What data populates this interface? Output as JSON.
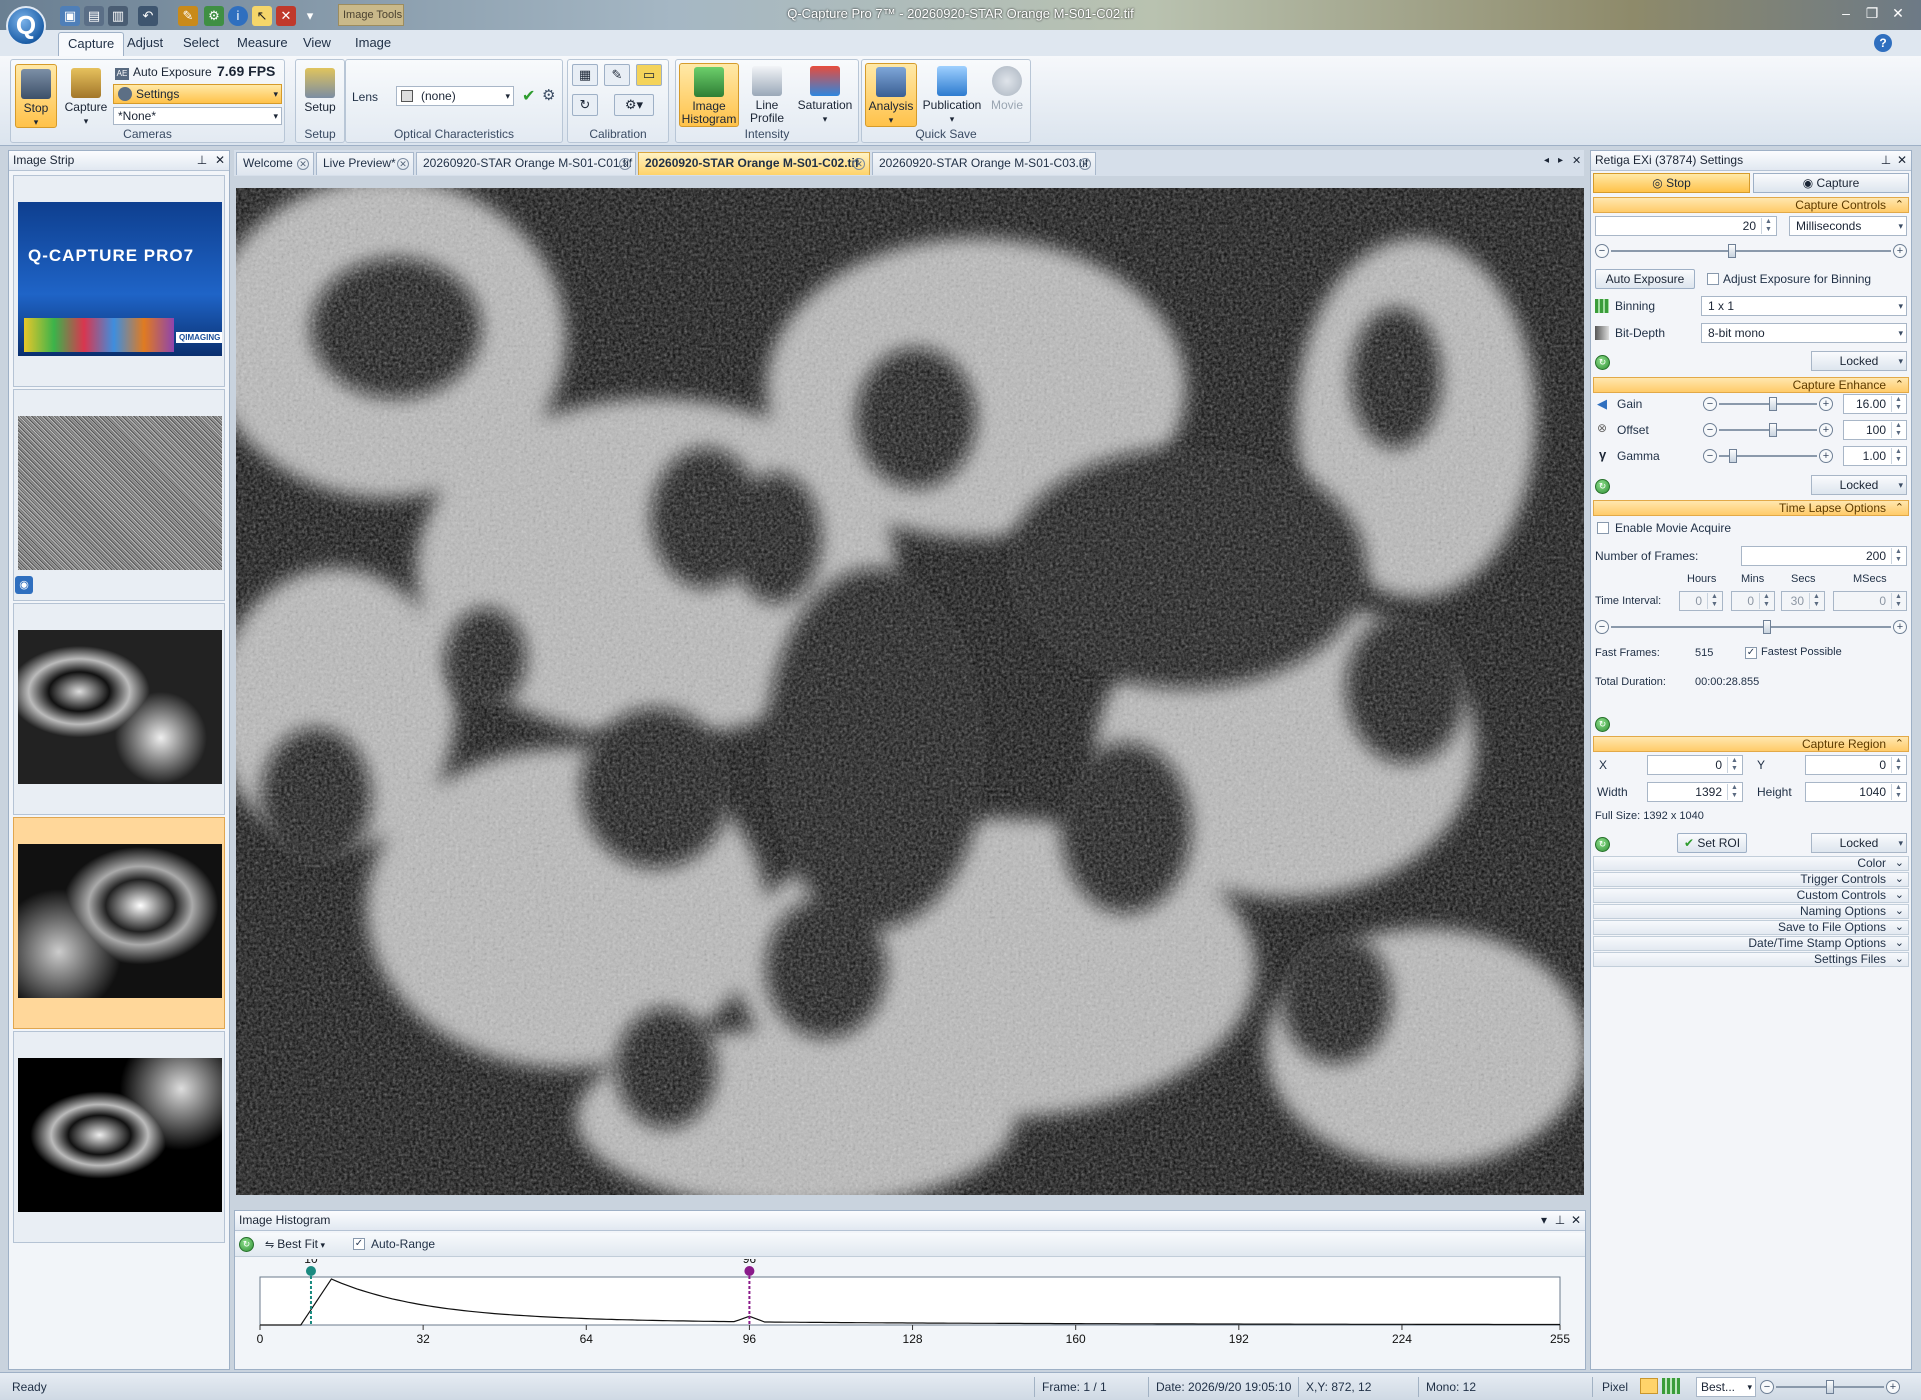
{
  "window": {
    "title": "Q-Capture Pro 7™ - 20260920-STAR Orange M-S01-C02.tif",
    "context_tab": "Image Tools",
    "logo_letter": "Q"
  },
  "ribbon": {
    "tabs": [
      "Capture",
      "Adjust",
      "Select",
      "Measure",
      "View",
      "Image"
    ],
    "active_tab": "Capture",
    "cameras": {
      "group_label": "Cameras",
      "stop": "Stop",
      "capture": "Capture",
      "auto_exposure": "Auto Exposure",
      "fps": "7.69 FPS",
      "settings": "Settings",
      "preset": "*None*"
    },
    "setup": {
      "group_label": "Setup",
      "button": "Setup"
    },
    "optical": {
      "group_label": "Optical Characteristics",
      "lens_label": "Lens",
      "lens_value": "(none)"
    },
    "calibration": {
      "group_label": "Calibration"
    },
    "intensity": {
      "group_label": "Intensity",
      "histogram": "Image Histogram",
      "line_profile": "Line Profile",
      "saturation": "Saturation"
    },
    "quick_save": {
      "group_label": "Quick Save",
      "analysis": "Analysis",
      "publication": "Publication",
      "movie": "Movie"
    }
  },
  "image_strip": {
    "title": "Image Strip",
    "splash_title": "Q-CAPTURE PRO7",
    "splash_brand": "QIMAGING"
  },
  "doc_tabs": [
    {
      "label": "Welcome"
    },
    {
      "label": "Live Preview*"
    },
    {
      "label": "20260920-STAR Orange M-S01-C01.tif"
    },
    {
      "label": "20260920-STAR Orange M-S01-C02.tif"
    },
    {
      "label": "20260920-STAR Orange M-S01-C03.tif"
    }
  ],
  "histogram": {
    "title": "Image Histogram",
    "fit": "Best Fit",
    "auto_range": "Auto-Range",
    "auto_range_checked": true,
    "low_marker": 10,
    "high_marker": 96,
    "ticks": [
      0,
      32,
      64,
      96,
      128,
      160,
      192,
      224,
      255
    ],
    "low_marker_color": "#1a8a80",
    "high_marker_color": "#8a1a8a"
  },
  "settings": {
    "title": "Retiga EXi (37874) Settings",
    "stop_tab": "Stop",
    "capture_tab": "Capture",
    "capture_controls": {
      "title": "Capture Controls",
      "exposure": "20",
      "unit": "Milliseconds",
      "auto_exposure_button": "Auto Exposure",
      "adjust_binning_label": "Adjust Exposure for Binning",
      "binning_label": "Binning",
      "binning_value": "1 x 1",
      "bitdepth_label": "Bit-Depth",
      "bitdepth_value": "8-bit mono",
      "locked": "Locked"
    },
    "capture_enhance": {
      "title": "Capture Enhance",
      "gain_label": "Gain",
      "gain_value": "16.00",
      "offset_label": "Offset",
      "offset_value": "100",
      "gamma_label": "Gamma",
      "gamma_value": "1.00",
      "locked": "Locked"
    },
    "time_lapse": {
      "title": "Time Lapse Options",
      "enable_movie": "Enable Movie Acquire",
      "frames_label": "Number of Frames:",
      "frames_value": "200",
      "hours": "Hours",
      "mins": "Mins",
      "secs": "Secs",
      "msecs": "MSecs",
      "interval_label": "Time Interval:",
      "hours_value": "0",
      "mins_value": "0",
      "secs_value": "30",
      "msecs_value": "0",
      "fast_frames_label": "Fast Frames:",
      "fast_frames_value": "515",
      "fastest_label": "Fastest Possible",
      "fastest_checked": true,
      "duration_label": "Total Duration:",
      "duration_value": "00:00:28.855"
    },
    "capture_region": {
      "title": "Capture Region",
      "x_label": "X",
      "x_value": "0",
      "y_label": "Y",
      "y_value": "0",
      "width_label": "Width",
      "width_value": "1392",
      "height_label": "Height",
      "height_value": "1040",
      "full_size": "Full Size: 1392 x 1040",
      "set_roi": "Set ROI",
      "locked": "Locked"
    },
    "collapsed": [
      "Color",
      "Trigger Controls",
      "Custom Controls",
      "Naming Options",
      "Save to File Options",
      "Date/Time Stamp Options",
      "Settings Files"
    ]
  },
  "status": {
    "ready": "Ready",
    "frame": "Frame: 1 / 1",
    "date": "Date: 2026/9/20 19:05:10",
    "xy": "X,Y:  872,   12",
    "mono": "Mono:   12",
    "unit": "Pixel",
    "zoom": "Best..."
  }
}
